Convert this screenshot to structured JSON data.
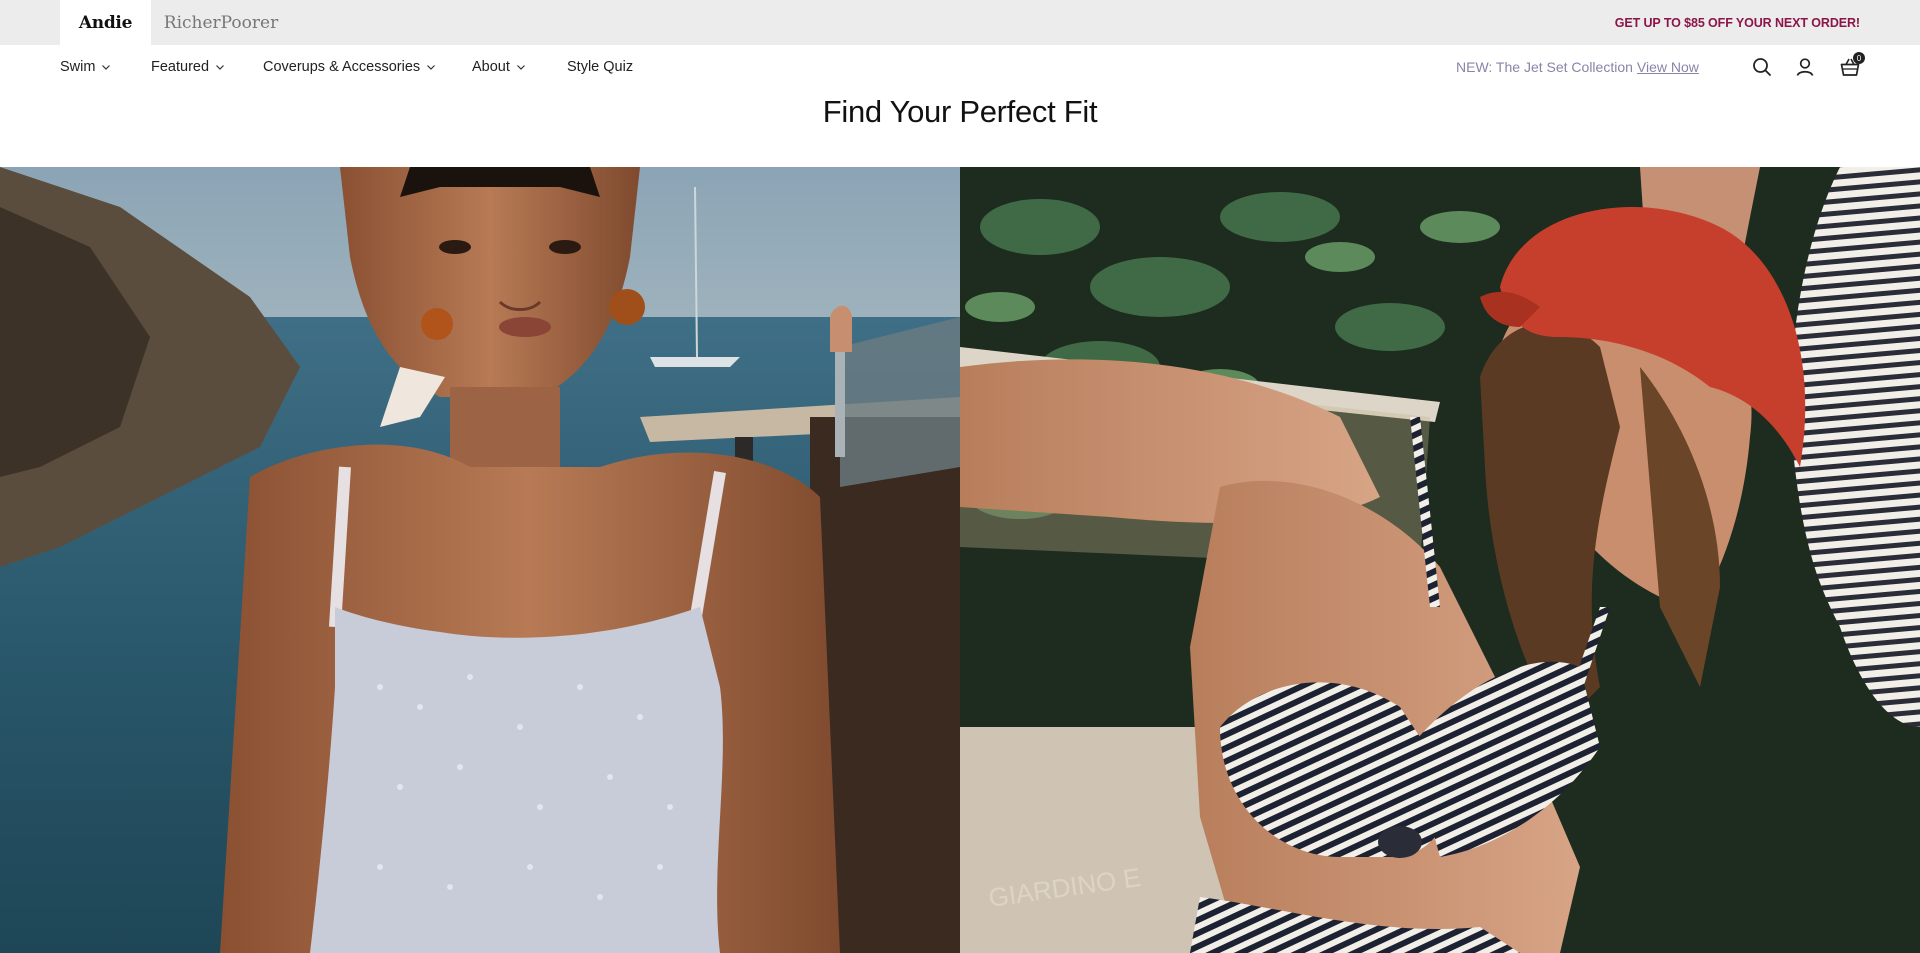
{
  "topbar": {
    "brands": [
      "Andie",
      "RicherPoorer"
    ],
    "promo": "GET UP TO $85 OFF YOUR NEXT ORDER!"
  },
  "nav": {
    "items": [
      {
        "label": "Swim",
        "has_dropdown": true
      },
      {
        "label": "Featured",
        "has_dropdown": true
      },
      {
        "label": "Coverups & Accessories",
        "has_dropdown": true
      },
      {
        "label": "About",
        "has_dropdown": true
      },
      {
        "label": "Style Quiz",
        "has_dropdown": false
      }
    ],
    "announcement": {
      "text": "NEW: The Jet Set Collection",
      "link": "View Now"
    },
    "icons": [
      "search-icon",
      "account-icon",
      "cart-icon"
    ],
    "cart_count": "0"
  },
  "main": {
    "title": "Find Your Perfect Fit",
    "hero_watermark": "GIARDINO E"
  },
  "colors": {
    "promo": "#8b1547",
    "announcement": "#8a84a8",
    "topbar_bg": "#ececec"
  }
}
